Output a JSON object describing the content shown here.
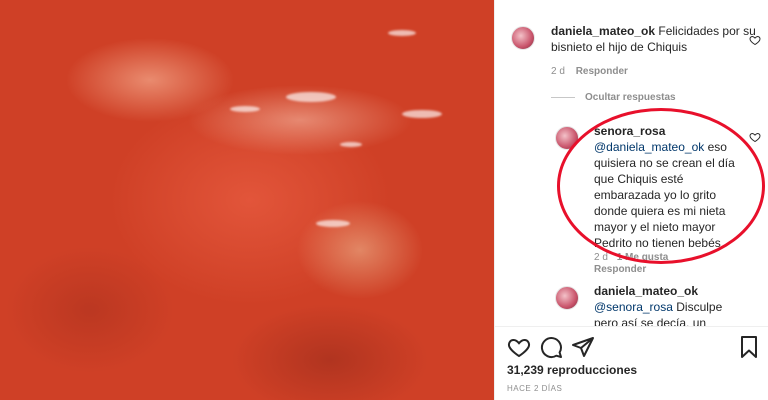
{
  "comments": [
    {
      "username": "daniela_mateo_ok",
      "text": "Felicidades por su bisnieto el hijo de Chiquis",
      "time": "2 d",
      "reply_label": "Responder"
    },
    {
      "username": "senora_rosa",
      "mention": "@daniela_mateo_ok",
      "text": "eso quisiera no se crean el día que Chiquis esté embarazada yo lo grito donde quiera es mi nieta mayor y el nieto mayor Pedrito no tienen bebés",
      "time": "2 d",
      "likes": "1 Me gusta",
      "reply_label": "Responder"
    },
    {
      "username": "daniela_mateo_ok",
      "mention": "@senora_rosa",
      "text": "Disculpe pero así se decía, un"
    }
  ],
  "hide_replies_label": "Ocultar respuestas",
  "stats": {
    "views": "31,239 reproducciones",
    "posted": "HACE 2 DÍAS"
  },
  "icons": {
    "like": "heart-icon",
    "comment": "comment-icon",
    "share": "paper-plane-icon",
    "save": "bookmark-icon"
  },
  "colors": {
    "highlight_circle": "#e8102b",
    "video_tint": "#d9472d",
    "mention": "#00376b"
  }
}
